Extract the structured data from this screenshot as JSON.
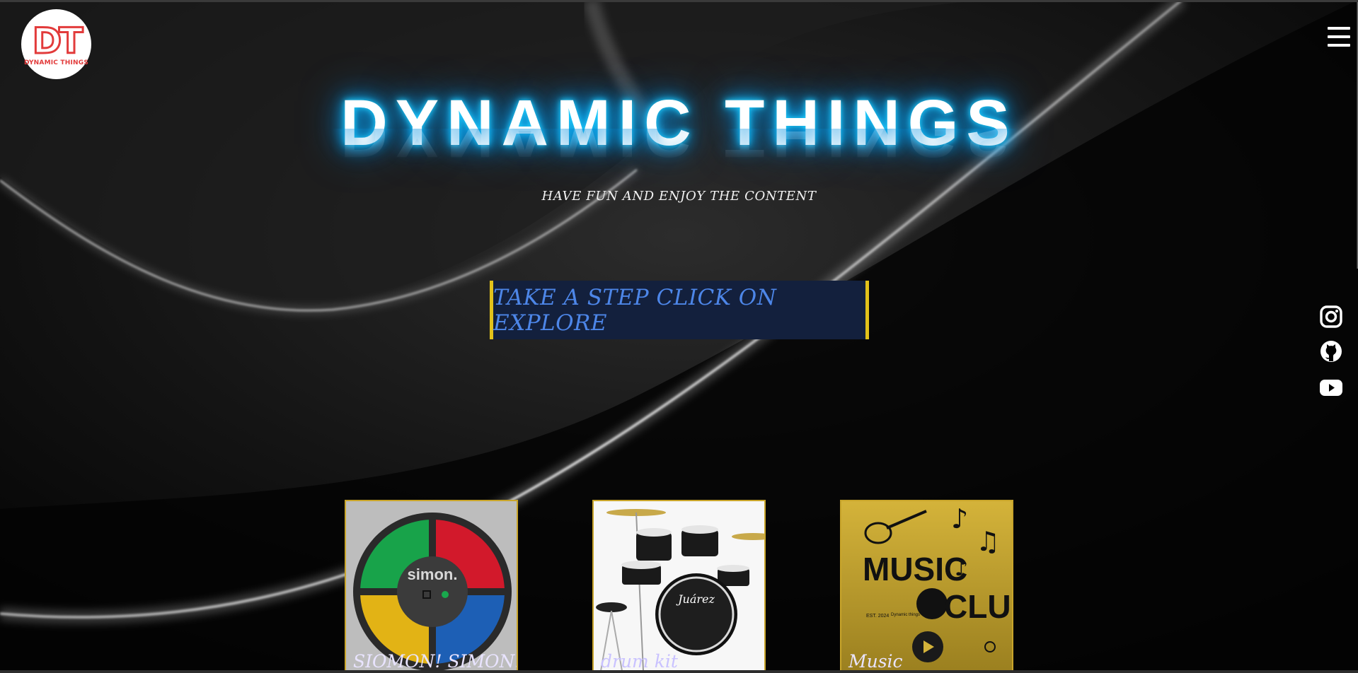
{
  "brand": {
    "logo_mark": "DT",
    "logo_text": "DYNAMIC THINGS"
  },
  "hero": {
    "title": "DYNAMIC THINGS",
    "subtitle": "HAVE FUN AND ENJOY THE CONTENT",
    "cta_label": "TAKE A STEP CLICK ON EXPLORE"
  },
  "icons": {
    "menu": "hamburger-menu-icon",
    "social": [
      "instagram-icon",
      "github-icon",
      "youtube-icon"
    ]
  },
  "cards": [
    {
      "label": "SIOMON! SIMON!",
      "image": "simon-game-image"
    },
    {
      "label": "drum kit",
      "image": "drum-kit-image"
    },
    {
      "label": "Music",
      "image": "music-club-image"
    }
  ],
  "music_card": {
    "line1": "MUSIC",
    "line2": "CLUB",
    "est": "EST. 2024",
    "caption": "Dynamic things"
  },
  "simon_card": {
    "brand": "simon."
  },
  "drum_card": {
    "brand": "Juárez"
  },
  "colors": {
    "title_glow": "#12b8ff",
    "cta_bg": "#13203d",
    "cta_text": "#4d86e8",
    "cta_border": "#e3c21a",
    "card_border": "#c9a52a",
    "logo_red": "#e23b3b"
  }
}
